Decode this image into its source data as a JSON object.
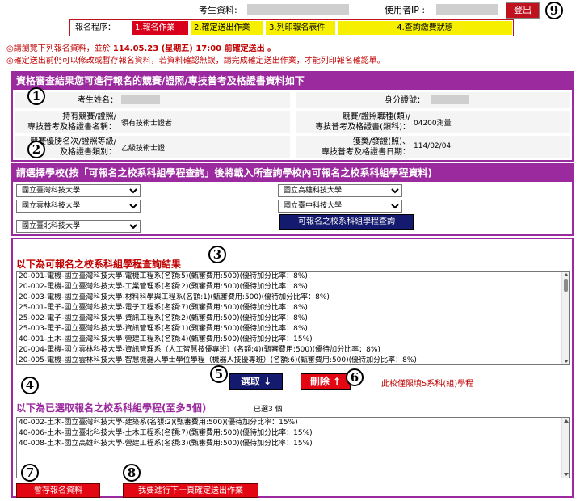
{
  "header": {
    "applicant_label": "考生資料:",
    "user_ip_label": "使用者IP :",
    "logout_label": "登出"
  },
  "steps": {
    "label": "報名程序：",
    "items": [
      {
        "label": "1.報名作業",
        "active": true
      },
      {
        "label": "2.確定送出作業",
        "active": false
      },
      {
        "label": "3.列印報名表件",
        "active": false
      },
      {
        "label": "4.查詢繳費狀態",
        "active": false
      }
    ]
  },
  "notices": {
    "line1_prefix": "◎請瀏覽下列報名資料，並於 ",
    "line1_deadline": "114.05.23 (星期五) 17:00",
    "line1_suffix": " 前確定送出 。",
    "line2": "◎確定送出前仍可以修改或暫存報名資料，若資料確認無誤，請完成確定送出作業，才能列印報名確認單。"
  },
  "qualification": {
    "title": "資格審查結果您可進行報名的競賽/證照/專技普考及格證書資料如下",
    "name_label": "考生姓名：",
    "id_label": "身分證號：",
    "cert_name_label": [
      "持有競賽/證照/",
      "專技普考及格證書名稱："
    ],
    "cert_name_value": "領有技術士證者",
    "cert_category_label": [
      "競賽/證照職種(類)/",
      "專技普考及格證書(類科)："
    ],
    "cert_category_value": "04200測量",
    "rank_label": [
      "競賽優勝名次/證照等級/",
      "及格證書類別："
    ],
    "rank_value": "乙級技術士證",
    "award_date_label": [
      "獲獎/發證(照)、",
      "專技普考及格證書日期："
    ],
    "award_date_value": "114/02/04"
  },
  "school_select": {
    "title": "請選擇學校(按「可報名之校系科組學程查詢」後將載入所查詢學校內可報名之校系科組學程資料)",
    "selects": [
      "國立臺灣科技大學",
      "國立高雄科技大學",
      "國立雲林科技大學",
      "國立臺中科技大學",
      "國立臺北科技大學"
    ],
    "query_button": "可報名之校系科組學程查詢"
  },
  "results": {
    "title": "以下為可報名之校系科組學程查詢結果",
    "items": [
      "20-001-電機-國立臺灣科技大學-電機工程系(名額:5)(甄審費用:500)(優待加分比率：8%)",
      "20-002-電機-國立臺灣科技大學-工業管理系(名額:2)(甄審費用:500)(優待加分比率：8%)",
      "20-003-電機-國立臺灣科技大學-材料科學與工程系(名額:1)(甄審費用:500)(優待加分比率：8%)",
      "25-001-電子-國立臺灣科技大學-電子工程系(名額:7)(甄審費用:500)(優待加分比率：8%)",
      "25-002-電子-國立臺灣科技大學-資訊工程系(名額:2)(甄審費用:500)(優待加分比率：8%)",
      "25-003-電子-國立臺灣科技大學-資訊管理系(名額:1)(甄審費用:500)(優待加分比率：8%)",
      "40-001-土木-國立臺灣科技大學-營建工程系(名額:4)(甄審費用:500)(優待加分比率：15%)",
      "20-004-電機-國立雲林科技大學-資訊管理系（人工智慧技優專班）(名額:4)(甄審費用:500)(優待加分比率：8%)",
      "20-005-電機-國立雲林科技大學-智慧機器人學士學位學程（機器人技優專班）(名額:6)(甄審費用:500)(優待加分比率：8%)"
    ],
    "select_button": "選取 ↓",
    "delete_button": "刪除 ↑",
    "limit_note": "此校僅限填5系科(組)學程"
  },
  "selected": {
    "title": "以下為已選取報名之校系科組學程(至多5個)",
    "count_note": "已選3 個",
    "items": [
      "40-002-土木-國立臺灣科技大學-建築系(名額:2)(甄審費用:500)(優待加分比率：15%)",
      "40-006-土木-國立臺北科技大學-土木工程系(名額:7)(甄審費用:500)(優待加分比率：15%)",
      "40-008-土木-國立高雄科技大學-營建工程系(名額:3)(甄審費用:500)(優待加分比率：15%)"
    ]
  },
  "actions": {
    "save_button": "暫存報名資料",
    "next_button": "我要進行下一頁確定送出作業"
  },
  "markers": [
    "1",
    "2",
    "3",
    "4",
    "5",
    "6",
    "7",
    "8",
    "9"
  ],
  "colors": {
    "panel_purple": "#9b2a9e",
    "active_step_red": "#d9001b",
    "step_yellow": "#f6ef00",
    "notice_red": "#c00000",
    "query_navy": "#141a6e"
  }
}
